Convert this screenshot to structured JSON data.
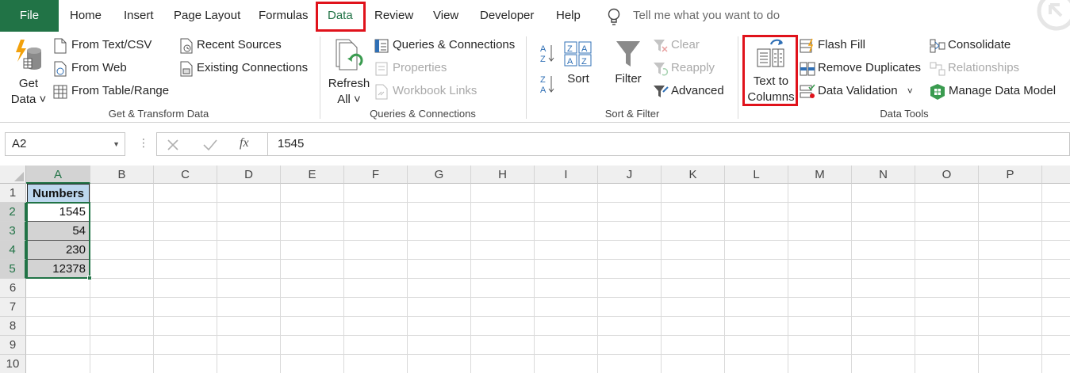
{
  "tabs": [
    "File",
    "Home",
    "Insert",
    "Page Layout",
    "Formulas",
    "Data",
    "Review",
    "View",
    "Developer",
    "Help"
  ],
  "active_tab": "Data",
  "tell_me": "Tell me what you want to do",
  "ribbon": {
    "get_transform": {
      "get_data": [
        "Get",
        "Data"
      ],
      "from_text_csv": "From Text/CSV",
      "from_web": "From Web",
      "from_table_range": "From Table/Range",
      "recent_sources": "Recent Sources",
      "existing_connections": "Existing Connections",
      "label": "Get & Transform Data"
    },
    "queries": {
      "refresh_all": [
        "Refresh",
        "All"
      ],
      "queries_connections": "Queries & Connections",
      "properties": "Properties",
      "workbook_links": "Workbook Links",
      "label": "Queries & Connections"
    },
    "sort_filter": {
      "sort": "Sort",
      "filter": "Filter",
      "clear": "Clear",
      "reapply": "Reapply",
      "advanced": "Advanced",
      "label": "Sort & Filter"
    },
    "data_tools": {
      "text_to_columns": [
        "Text to",
        "Columns"
      ],
      "flash_fill": "Flash Fill",
      "remove_duplicates": "Remove Duplicates",
      "data_validation": "Data Validation",
      "consolidate": "Consolidate",
      "relationships": "Relationships",
      "manage_data_model": "Manage Data Model",
      "label": "Data Tools"
    }
  },
  "name_box": "A2",
  "formula": "1545",
  "columns": [
    "A",
    "B",
    "C",
    "D",
    "E",
    "F",
    "G",
    "H",
    "I",
    "J",
    "K",
    "L",
    "M",
    "N",
    "O",
    "P"
  ],
  "rows": [
    "1",
    "2",
    "3",
    "4",
    "5",
    "6",
    "7",
    "8",
    "9",
    "10"
  ],
  "cells": {
    "header": "Numbers",
    "values": [
      "1545",
      "54",
      "230",
      "12378"
    ]
  },
  "colors": {
    "accent": "#217346",
    "highlight": "#e0121b",
    "selection": "#d3d3d3",
    "header_fill": "#bdd7ee"
  }
}
